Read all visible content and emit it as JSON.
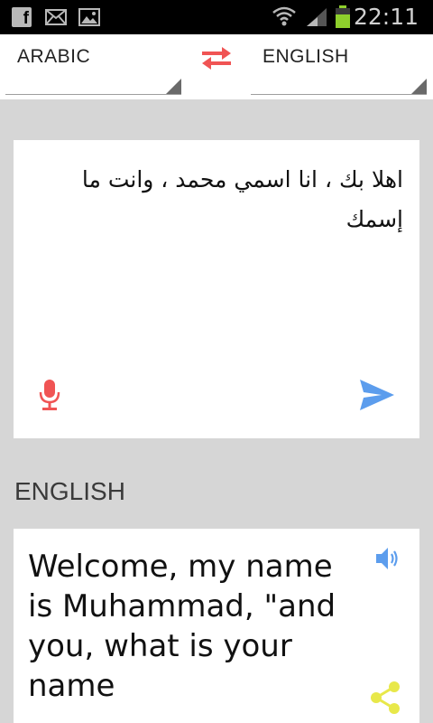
{
  "status_bar": {
    "time": "22:11",
    "notification_icons": [
      "facebook-icon",
      "mail-icon",
      "photo-icon"
    ],
    "system_icons": [
      "wifi-icon",
      "signal-icon",
      "battery-icon"
    ],
    "facebook_glyph": "f"
  },
  "language_bar": {
    "source_language": "ARABIC",
    "target_language": "ENGLISH",
    "swap_icon": "swap-arrows-icon"
  },
  "input": {
    "text": "اهلا بك ، انا اسمي محمد ، وانت ما إسمك",
    "mic_icon": "microphone-icon",
    "send_icon": "send-icon"
  },
  "result": {
    "language_label": "ENGLISH",
    "text": "Welcome, my name is Muhammad, \"and you, what is your name",
    "speaker_icon": "speaker-icon",
    "share_icon": "share-icon"
  },
  "colors": {
    "accent_red": "#f05454",
    "accent_blue": "#5c9ded",
    "accent_yellow": "#e8e84a",
    "battery_green": "#8ecf2c"
  }
}
